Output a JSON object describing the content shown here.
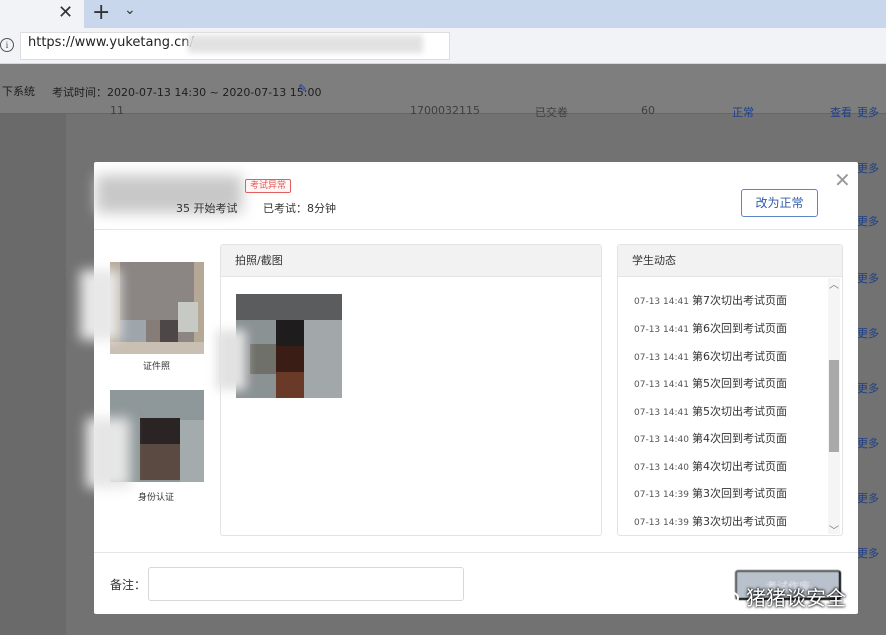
{
  "browser": {
    "tab_close": "✕",
    "new_tab": "+",
    "tab_list": "⌄",
    "url": "https://www.yuketang.cn/"
  },
  "page": {
    "system_title": "下系统",
    "exam_time": "考试时间：2020-07-13 14:30 ~ 2020-07-13 15:00",
    "more_label": "更多",
    "bg_row": {
      "index": "11",
      "student_id": "1700032115",
      "status": "已交卷",
      "score": "60",
      "state": "正常",
      "view": "查看"
    }
  },
  "modal": {
    "badge": "考试异常",
    "start_text": "35 开始考试",
    "elapsed": "已考试：8分钟",
    "normal_button": "改为正常",
    "id_photo_caption": "证件照",
    "identity_caption": "身份认证",
    "photo_panel_title": "拍照/截图",
    "activity_panel_title": "学生动态",
    "activity_log": [
      {
        "time": "07-13 14:41",
        "event": "第7次切出考试页面"
      },
      {
        "time": "07-13 14:41",
        "event": "第6次回到考试页面"
      },
      {
        "time": "07-13 14:41",
        "event": "第6次切出考试页面"
      },
      {
        "time": "07-13 14:41",
        "event": "第5次回到考试页面"
      },
      {
        "time": "07-13 14:41",
        "event": "第5次切出考试页面"
      },
      {
        "time": "07-13 14:40",
        "event": "第4次回到考试页面"
      },
      {
        "time": "07-13 14:40",
        "event": "第4次切出考试页面"
      },
      {
        "time": "07-13 14:39",
        "event": "第3次回到考试页面"
      },
      {
        "time": "07-13 14:39",
        "event": "第3次切出考试页面"
      }
    ],
    "remark_label": "备注：",
    "remark_value": "",
    "finish_button": "考试作废"
  },
  "watermark": "猪猪谈安全",
  "colors": {
    "accent": "#2e5da8",
    "badge": "#e06060",
    "overlay": "#727272"
  }
}
